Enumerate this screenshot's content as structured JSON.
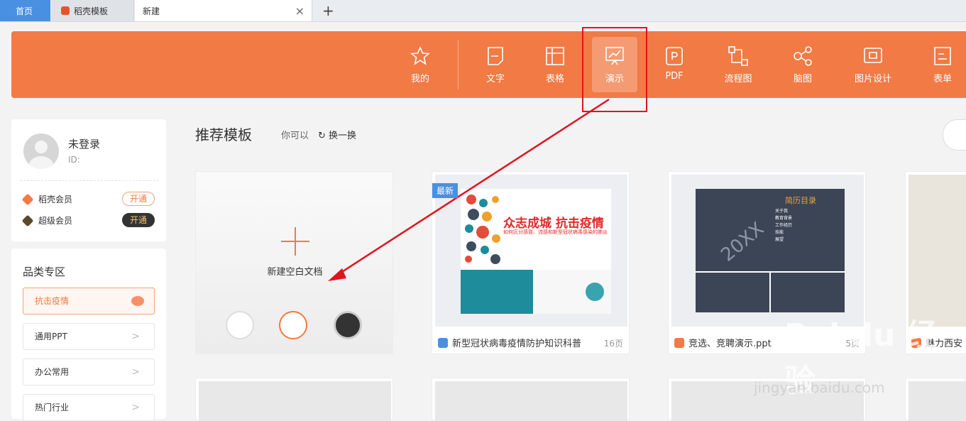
{
  "tabs": {
    "home": "首页",
    "docer": "稻壳模板",
    "new": "新建",
    "close": "×",
    "add": "+"
  },
  "categories": [
    {
      "label": "我的",
      "icon": "star-icon"
    },
    {
      "label": "文字",
      "icon": "document-icon"
    },
    {
      "label": "表格",
      "icon": "table-icon"
    },
    {
      "label": "演示",
      "icon": "presentation-icon",
      "active": true
    },
    {
      "label": "PDF",
      "icon": "pdf-icon"
    },
    {
      "label": "流程图",
      "icon": "flowchart-icon"
    },
    {
      "label": "脑图",
      "icon": "mindmap-icon"
    },
    {
      "label": "图片设计",
      "icon": "image-design-icon"
    },
    {
      "label": "表单",
      "icon": "form-icon"
    }
  ],
  "user": {
    "name": "未登录",
    "id": "ID:",
    "members": [
      {
        "label": "稻壳会员",
        "button": "开通"
      },
      {
        "label": "超级会员",
        "button": "开通"
      }
    ]
  },
  "sidebar": {
    "title": "品类专区",
    "items": [
      {
        "label": "抗击疫情",
        "active": true
      },
      {
        "label": "通用PPT"
      },
      {
        "label": "办公常用"
      },
      {
        "label": "热门行业"
      }
    ]
  },
  "main": {
    "title": "推荐模板",
    "hint": "你可以",
    "swap": "换一换",
    "blank_label": "新建空白文档",
    "cards": [
      {
        "tag": "最新",
        "caption": "新型冠状病毒疫情防护知识科普",
        "pages": "16页",
        "slide_title": "众志成城 抗击疫情",
        "slide_sub": "如何区分感冒、流感和新型冠状病毒感染的肺炎"
      },
      {
        "caption": "竞选、竞聘演示.ppt",
        "pages": "5页",
        "slide_title": "简历目录",
        "slide_items": [
          "关于我",
          "教育背景",
          "工作经历",
          "技能",
          "展望"
        ],
        "slide_big": "20XX"
      },
      {
        "caption": "魅力西安"
      }
    ]
  },
  "colors": {
    "accent": "#f17a45",
    "tab_active": "#4a90e2",
    "annotation": "#e0141f"
  },
  "watermark": {
    "logo": "Bai du 经验",
    "url": "jingyan.baidu.com"
  }
}
